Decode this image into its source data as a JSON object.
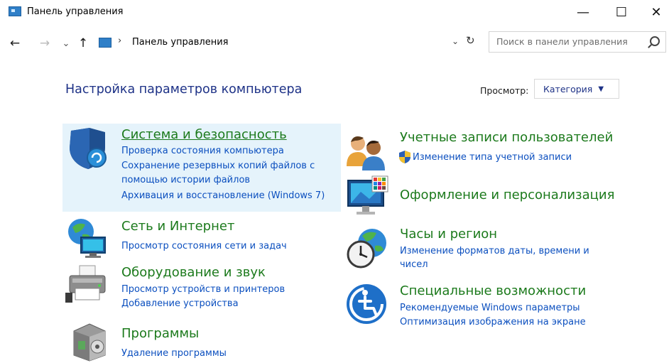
{
  "window": {
    "title": "Панель управления",
    "controls": {
      "minimize": "—",
      "maximize": "☐",
      "close": "✕"
    }
  },
  "nav": {
    "back": "←",
    "forward": "→",
    "recent": "⌄",
    "up": "↑",
    "address_separator": "›",
    "address": "Панель управления",
    "address_dropdown": "⌄",
    "refresh": "↻"
  },
  "search": {
    "placeholder": "Поиск в панели управления"
  },
  "header": {
    "title": "Настройка параметров компьютера",
    "view_label": "Просмотр:",
    "view_value": "Категория"
  },
  "categories": [
    {
      "title": "Система и безопасность",
      "icon": "shield-icon",
      "links": [
        "Проверка состояния компьютера",
        "Сохранение резервных копий файлов с",
        "помощью истории файлов",
        "Архивация и восстановление (Windows 7)"
      ]
    },
    {
      "title": "Сеть и Интернет",
      "icon": "network-globe-icon",
      "links": [
        "Просмотр состояния сети и задач"
      ]
    },
    {
      "title": "Оборудование и звук",
      "icon": "printer-icon",
      "links": [
        "Просмотр устройств и принтеров",
        "Добавление устройства"
      ]
    },
    {
      "title": "Программы",
      "icon": "programs-box-icon",
      "links": [
        "Удаление программы"
      ]
    },
    {
      "title": "Учетные записи пользователей",
      "icon": "users-icon",
      "links": [
        "Изменение типа учетной записи"
      ]
    },
    {
      "title": "Оформление и персонализация",
      "icon": "monitor-palette-icon",
      "links": []
    },
    {
      "title": "Часы и регион",
      "icon": "clock-globe-icon",
      "links": [
        "Изменение форматов даты, времени и",
        "чисел"
      ]
    },
    {
      "title": "Специальные возможности",
      "icon": "accessibility-icon",
      "links": [
        "Рекомендуемые Windows параметры",
        "Оптимизация изображения на экране"
      ]
    }
  ],
  "colors": {
    "category_title": "#1c7a1c",
    "link": "#0b4fbf",
    "highlight": "#e5f3fb",
    "heading": "#1e3287"
  }
}
